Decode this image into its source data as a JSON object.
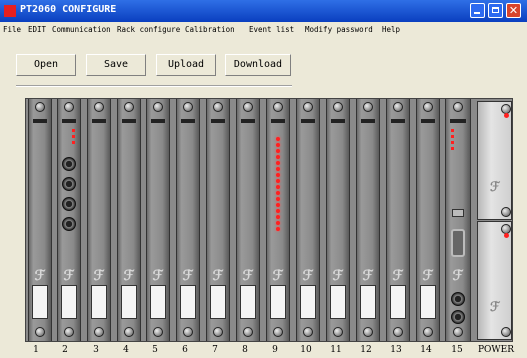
{
  "window": {
    "title": "PT2060 CONFIGURE"
  },
  "menu": [
    "File",
    "EDIT",
    "Communication",
    "Rack configure",
    "Calibration",
    "Event list",
    "Modify password",
    "Help"
  ],
  "toolbar": {
    "open": "Open",
    "save": "Save",
    "upload": "Upload",
    "download": "Download"
  },
  "slots": [
    "1",
    "2",
    "3",
    "4",
    "5",
    "6",
    "7",
    "8",
    "9",
    "10",
    "11",
    "12",
    "13",
    "14",
    "15",
    "POWER"
  ],
  "colors": {
    "titlebar": "#0a3fbf",
    "led": "#ff2020",
    "rack": "#8a8a8a",
    "close": "#d8452c"
  }
}
